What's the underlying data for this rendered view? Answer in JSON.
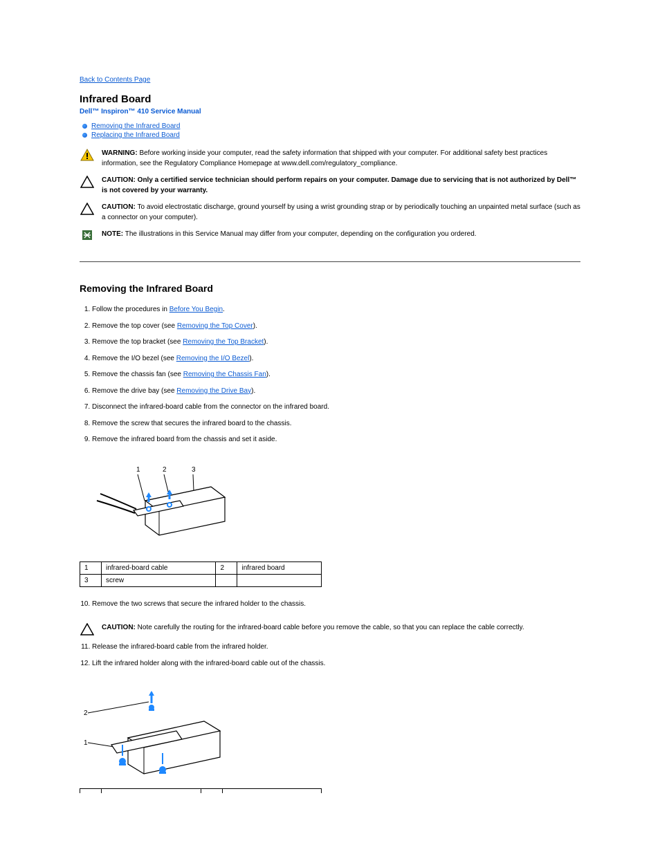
{
  "nav": {
    "back": "Back to Contents Page"
  },
  "title": "Infrared Board",
  "subtitle": "Dell™ Inspiron™ 410 Service Manual",
  "proc_links": [
    "Removing the Infrared Board",
    "Replacing the Infrared Board"
  ],
  "admon": {
    "warning": {
      "label": "WARNING:",
      "text": "Before working inside your computer, read the safety information that shipped with your computer. For additional safety best practices information, see the Regulatory Compliance Homepage at www.dell.com/regulatory_compliance."
    },
    "caution1": {
      "label": "CAUTION:",
      "text": "Only a certified service technician should perform repairs on your computer. Damage due to servicing that is not authorized by Dell™ is not covered by your warranty."
    },
    "caution2": {
      "label": "CAUTION:",
      "text": "To avoid electrostatic discharge, ground yourself by using a wrist grounding strap or by periodically touching an unpainted metal surface (such as a connector on your computer)."
    },
    "note": {
      "label": "NOTE:",
      "text": "The illustrations in this Service Manual may differ from your computer, depending on the configuration you ordered."
    }
  },
  "removing": {
    "title": "Removing the Infrared Board",
    "steps": [
      {
        "pre": "Follow the procedures in ",
        "link": "Before You Begin",
        "post": "."
      },
      {
        "pre": "Remove the top cover (see ",
        "link": "Removing the Top Cover",
        "post": ")."
      },
      {
        "pre": "Remove the top bracket (see ",
        "link": "Removing the Top Bracket",
        "post": ")."
      },
      {
        "pre": "Remove the I/O bezel (see ",
        "link": "Removing the I/O Bezel",
        "post": ")."
      },
      {
        "pre": "Remove the chassis fan (see ",
        "link": "Removing the Chassis Fan",
        "post": ")."
      },
      {
        "pre": "Remove the drive bay (see ",
        "link": "Removing the Drive Bay",
        "post": ")."
      },
      {
        "pre": "Disconnect the infrared-board cable from the connector on the infrared board."
      },
      {
        "pre": "Remove the screw that secures the infrared board to the chassis."
      },
      {
        "pre": "Remove the infrared board from the chassis and set it aside."
      }
    ],
    "legend1": {
      "rows": [
        [
          "1",
          "infrared-board cable",
          "2",
          "infrared board"
        ],
        [
          "3",
          "screw",
          "",
          ""
        ]
      ]
    },
    "step10": "Remove the two screws that secure the infrared holder to the chassis.",
    "caution3": {
      "label": "CAUTION:",
      "text": "Note carefully the routing for the infrared-board cable before you remove the cable, so that you can replace the cable correctly."
    },
    "step11": "Release the infrared-board cable from the infrared holder.",
    "step12": "Lift the infrared holder along with the infrared-board cable out of the chassis."
  }
}
